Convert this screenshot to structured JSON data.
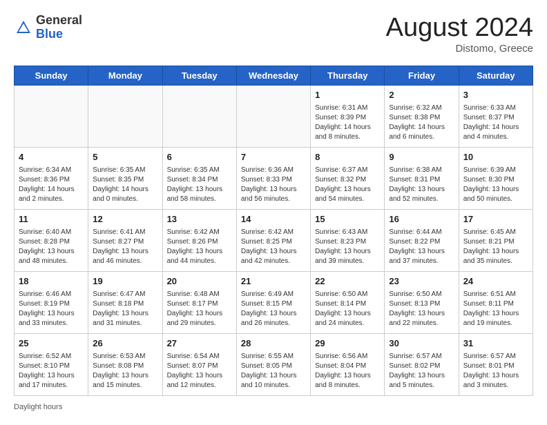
{
  "header": {
    "logo_general": "General",
    "logo_blue": "Blue",
    "month_year": "August 2024",
    "location": "Distomo, Greece"
  },
  "days_of_week": [
    "Sunday",
    "Monday",
    "Tuesday",
    "Wednesday",
    "Thursday",
    "Friday",
    "Saturday"
  ],
  "weeks": [
    [
      {
        "num": "",
        "info": ""
      },
      {
        "num": "",
        "info": ""
      },
      {
        "num": "",
        "info": ""
      },
      {
        "num": "",
        "info": ""
      },
      {
        "num": "1",
        "info": "Sunrise: 6:31 AM\nSunset: 8:39 PM\nDaylight: 14 hours\nand 8 minutes."
      },
      {
        "num": "2",
        "info": "Sunrise: 6:32 AM\nSunset: 8:38 PM\nDaylight: 14 hours\nand 6 minutes."
      },
      {
        "num": "3",
        "info": "Sunrise: 6:33 AM\nSunset: 8:37 PM\nDaylight: 14 hours\nand 4 minutes."
      }
    ],
    [
      {
        "num": "4",
        "info": "Sunrise: 6:34 AM\nSunset: 8:36 PM\nDaylight: 14 hours\nand 2 minutes."
      },
      {
        "num": "5",
        "info": "Sunrise: 6:35 AM\nSunset: 8:35 PM\nDaylight: 14 hours\nand 0 minutes."
      },
      {
        "num": "6",
        "info": "Sunrise: 6:35 AM\nSunset: 8:34 PM\nDaylight: 13 hours\nand 58 minutes."
      },
      {
        "num": "7",
        "info": "Sunrise: 6:36 AM\nSunset: 8:33 PM\nDaylight: 13 hours\nand 56 minutes."
      },
      {
        "num": "8",
        "info": "Sunrise: 6:37 AM\nSunset: 8:32 PM\nDaylight: 13 hours\nand 54 minutes."
      },
      {
        "num": "9",
        "info": "Sunrise: 6:38 AM\nSunset: 8:31 PM\nDaylight: 13 hours\nand 52 minutes."
      },
      {
        "num": "10",
        "info": "Sunrise: 6:39 AM\nSunset: 8:30 PM\nDaylight: 13 hours\nand 50 minutes."
      }
    ],
    [
      {
        "num": "11",
        "info": "Sunrise: 6:40 AM\nSunset: 8:28 PM\nDaylight: 13 hours\nand 48 minutes."
      },
      {
        "num": "12",
        "info": "Sunrise: 6:41 AM\nSunset: 8:27 PM\nDaylight: 13 hours\nand 46 minutes."
      },
      {
        "num": "13",
        "info": "Sunrise: 6:42 AM\nSunset: 8:26 PM\nDaylight: 13 hours\nand 44 minutes."
      },
      {
        "num": "14",
        "info": "Sunrise: 6:42 AM\nSunset: 8:25 PM\nDaylight: 13 hours\nand 42 minutes."
      },
      {
        "num": "15",
        "info": "Sunrise: 6:43 AM\nSunset: 8:23 PM\nDaylight: 13 hours\nand 39 minutes."
      },
      {
        "num": "16",
        "info": "Sunrise: 6:44 AM\nSunset: 8:22 PM\nDaylight: 13 hours\nand 37 minutes."
      },
      {
        "num": "17",
        "info": "Sunrise: 6:45 AM\nSunset: 8:21 PM\nDaylight: 13 hours\nand 35 minutes."
      }
    ],
    [
      {
        "num": "18",
        "info": "Sunrise: 6:46 AM\nSunset: 8:19 PM\nDaylight: 13 hours\nand 33 minutes."
      },
      {
        "num": "19",
        "info": "Sunrise: 6:47 AM\nSunset: 8:18 PM\nDaylight: 13 hours\nand 31 minutes."
      },
      {
        "num": "20",
        "info": "Sunrise: 6:48 AM\nSunset: 8:17 PM\nDaylight: 13 hours\nand 29 minutes."
      },
      {
        "num": "21",
        "info": "Sunrise: 6:49 AM\nSunset: 8:15 PM\nDaylight: 13 hours\nand 26 minutes."
      },
      {
        "num": "22",
        "info": "Sunrise: 6:50 AM\nSunset: 8:14 PM\nDaylight: 13 hours\nand 24 minutes."
      },
      {
        "num": "23",
        "info": "Sunrise: 6:50 AM\nSunset: 8:13 PM\nDaylight: 13 hours\nand 22 minutes."
      },
      {
        "num": "24",
        "info": "Sunrise: 6:51 AM\nSunset: 8:11 PM\nDaylight: 13 hours\nand 19 minutes."
      }
    ],
    [
      {
        "num": "25",
        "info": "Sunrise: 6:52 AM\nSunset: 8:10 PM\nDaylight: 13 hours\nand 17 minutes."
      },
      {
        "num": "26",
        "info": "Sunrise: 6:53 AM\nSunset: 8:08 PM\nDaylight: 13 hours\nand 15 minutes."
      },
      {
        "num": "27",
        "info": "Sunrise: 6:54 AM\nSunset: 8:07 PM\nDaylight: 13 hours\nand 12 minutes."
      },
      {
        "num": "28",
        "info": "Sunrise: 6:55 AM\nSunset: 8:05 PM\nDaylight: 13 hours\nand 10 minutes."
      },
      {
        "num": "29",
        "info": "Sunrise: 6:56 AM\nSunset: 8:04 PM\nDaylight: 13 hours\nand 8 minutes."
      },
      {
        "num": "30",
        "info": "Sunrise: 6:57 AM\nSunset: 8:02 PM\nDaylight: 13 hours\nand 5 minutes."
      },
      {
        "num": "31",
        "info": "Sunrise: 6:57 AM\nSunset: 8:01 PM\nDaylight: 13 hours\nand 3 minutes."
      }
    ]
  ],
  "footer": {
    "daylight_label": "Daylight hours"
  }
}
